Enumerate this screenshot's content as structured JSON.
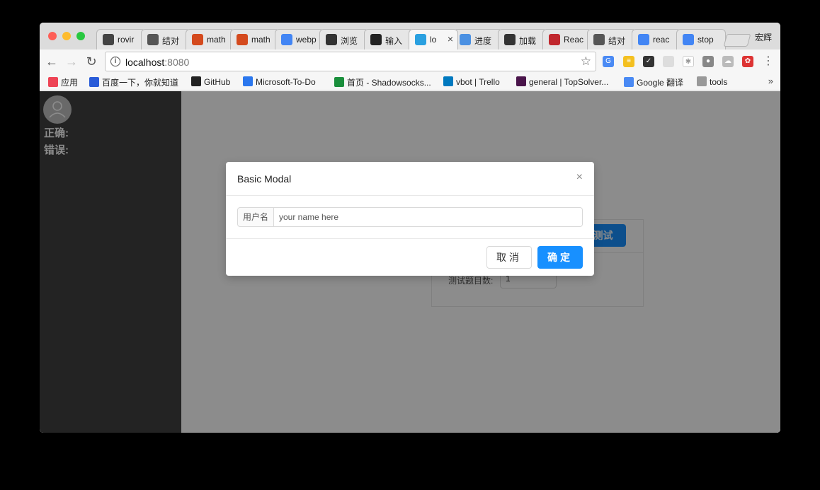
{
  "browser": {
    "tabs": [
      {
        "title": "rovir",
        "icon": "monster-icon",
        "color": "#444444"
      },
      {
        "title": "结对",
        "icon": "leaf-icon",
        "color": "#555555"
      },
      {
        "title": "math",
        "icon": "m-icon",
        "color": "#d44a1e"
      },
      {
        "title": "math",
        "icon": "m-icon",
        "color": "#d44a1e"
      },
      {
        "title": "webp",
        "icon": "google-icon",
        "color": "#4285f4"
      },
      {
        "title": "浏览",
        "icon": "book-icon",
        "color": "#333333"
      },
      {
        "title": "输入",
        "icon": "owl-icon",
        "color": "#222222"
      },
      {
        "title": "lo",
        "icon": "jump-icon",
        "color": "#2aa0e0"
      },
      {
        "title": "进度",
        "icon": "diamond-icon",
        "color": "#4a90e2"
      },
      {
        "title": "加载",
        "icon": "book-icon",
        "color": "#333333"
      },
      {
        "title": "Reac",
        "icon": "c-icon",
        "color": "#c0272d"
      },
      {
        "title": "结对",
        "icon": "leaf-icon",
        "color": "#555555"
      },
      {
        "title": "reac",
        "icon": "google-icon",
        "color": "#4285f4"
      },
      {
        "title": "stop",
        "icon": "google-icon",
        "color": "#4285f4"
      }
    ],
    "profile_name": "宏辉",
    "url_host": "localhost",
    "url_port": ":8080",
    "bookmarks": [
      {
        "label": "应用",
        "icon": "apps-icon"
      },
      {
        "label": "百度一下，你就知道",
        "icon": "baidu-paw-icon"
      },
      {
        "label": "GitHub",
        "icon": "github-icon"
      },
      {
        "label": "Microsoft-To-Do",
        "icon": "check-icon"
      },
      {
        "label": "首页 - Shadowsocks...",
        "icon": "paper-plane-icon"
      },
      {
        "label": "vbot | Trello",
        "icon": "trello-icon"
      },
      {
        "label": "general | TopSolver...",
        "icon": "slack-icon"
      },
      {
        "label": "Google 翻译",
        "icon": "translate-icon"
      },
      {
        "label": "tools",
        "icon": "folder-icon"
      }
    ],
    "bookmarks_more": "»"
  },
  "sidebar": {
    "correct_label": "正确:",
    "wrong_label": "错误:"
  },
  "background": {
    "test_button": "测试",
    "count_label": "测试题目数:",
    "count_value": "1"
  },
  "modal": {
    "title": "Basic Modal",
    "close_glyph": "×",
    "addon_label": "用户名",
    "input_placeholder": "your name here",
    "cancel_label": "取消",
    "ok_label": "确定"
  },
  "colors": {
    "primary": "#1890ff",
    "sidebar": "#404040"
  }
}
